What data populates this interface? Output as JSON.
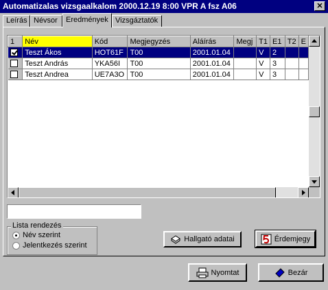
{
  "window": {
    "title": "Automatizalas vizsgaalkalom 2000.12.19 8:00  VPR A fsz A06",
    "close_glyph": "✕"
  },
  "tabs": [
    {
      "label": "Leírás"
    },
    {
      "label": "Névsor"
    },
    {
      "label": "Eredmények",
      "active": true
    },
    {
      "label": "Vizsgáztatók"
    }
  ],
  "grid": {
    "columns": [
      "1",
      "Név",
      "Kód",
      "Megjegyzés",
      "Aláírás",
      "Megj",
      "T1",
      "E1",
      "T2",
      "E"
    ],
    "rows": [
      {
        "checked": true,
        "name": "Teszt Ákos",
        "code": "HOT61F",
        "note": "T00",
        "date": "2001.01.04",
        "megj": "",
        "t1": "V",
        "e1": "2",
        "t2": "",
        "e": ""
      },
      {
        "checked": false,
        "name": "Teszt András",
        "code": "YKA56I",
        "note": "T00",
        "date": "2001.01.04",
        "megj": "",
        "t1": "V",
        "e1": "3",
        "t2": "",
        "e": ""
      },
      {
        "checked": false,
        "name": "Teszt Andrea",
        "code": "UE7A3O",
        "note": "T00",
        "date": "2001.01.04",
        "megj": "",
        "t1": "V",
        "e1": "3",
        "t2": "",
        "e": ""
      }
    ]
  },
  "search": {
    "value": ""
  },
  "sort_group": {
    "label": "Lista rendezés",
    "options": [
      {
        "label": "Név szerint",
        "selected": true
      },
      {
        "label": "Jelentkezés szerint",
        "selected": false
      }
    ]
  },
  "buttons": {
    "student_data": "Hallgató adatai",
    "grade": "Érdemjegy",
    "print": "Nyomtat",
    "close": "Bezár"
  }
}
